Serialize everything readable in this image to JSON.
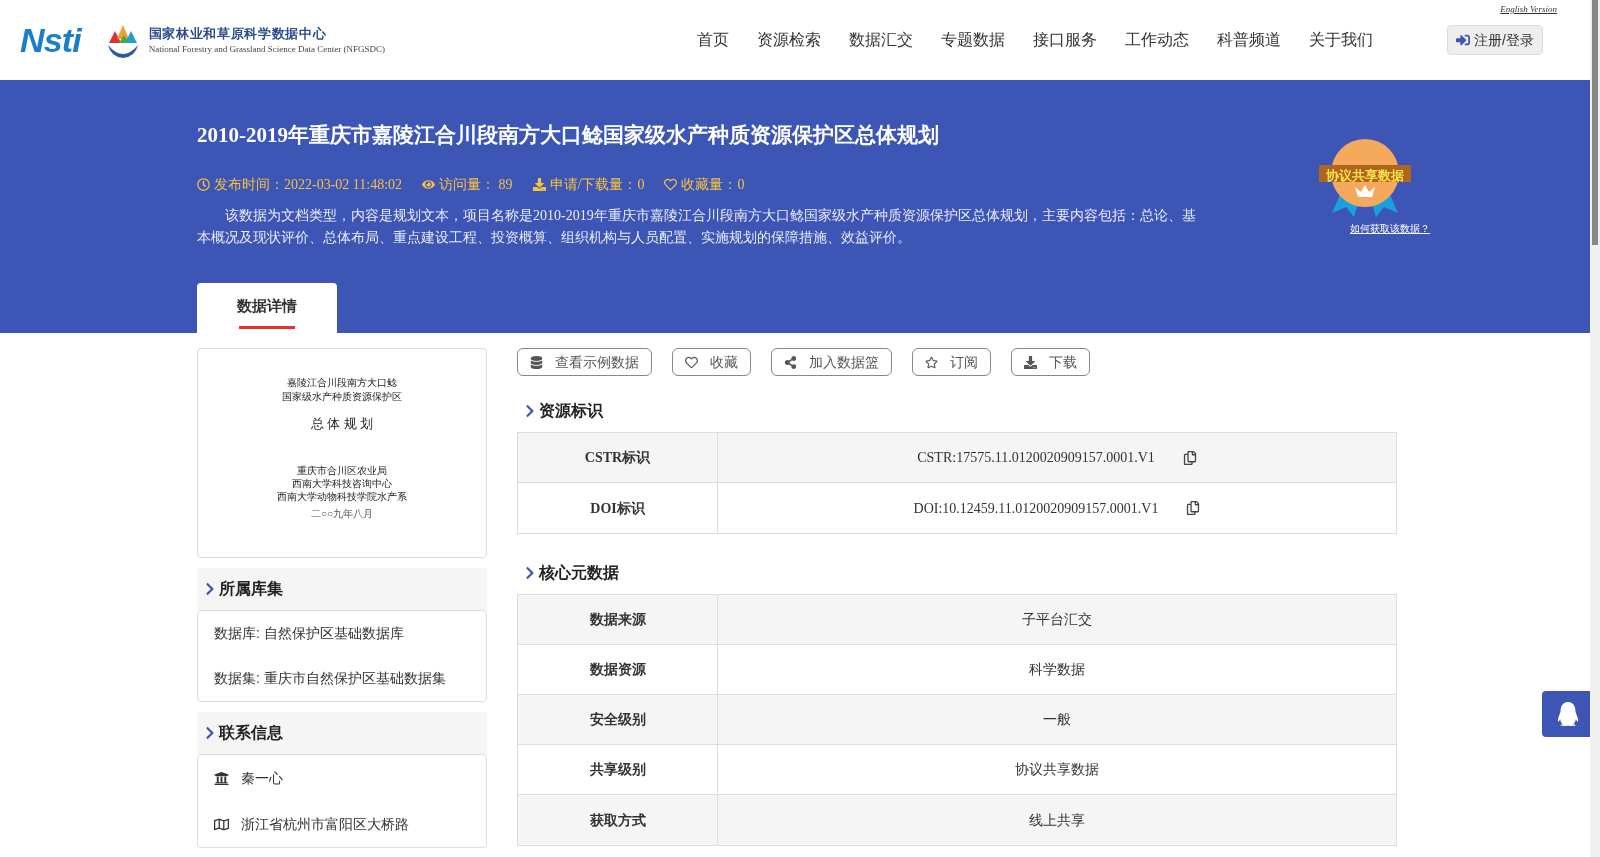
{
  "header": {
    "logo_text": "Nsti",
    "org_name": "国家林业和草原科学数据中心",
    "org_name_en": "National Forestry and Grassland Science Data Center (NFGSDC)",
    "english_link": "English Version",
    "nav": [
      {
        "label": "首页",
        "selected": false
      },
      {
        "label": "资源检索",
        "selected": false
      },
      {
        "label": "数据汇交",
        "selected": false
      },
      {
        "label": "专题数据",
        "selected": false
      },
      {
        "label": "接口服务",
        "selected": false
      },
      {
        "label": "工作动态",
        "selected": false
      },
      {
        "label": "科普频道",
        "selected": false
      },
      {
        "label": "关于我们",
        "selected": false
      }
    ],
    "login_button": "注册/登录"
  },
  "banner": {
    "title": "2010-2019年重庆市嘉陵江合川段南方大口鲶国家级水产种质资源保护区总体规划",
    "meta": [
      {
        "kind": "time",
        "text": "发布时间：2022-03-02 11:48:02"
      },
      {
        "kind": "views",
        "text": "访问量： 89"
      },
      {
        "kind": "downloads",
        "text": "申请/下载量：0"
      },
      {
        "kind": "favorites",
        "text": "收藏量：0"
      }
    ],
    "description": "该数据为文档类型，内容是规划文本，项目名称是2010-2019年重庆市嘉陵江合川段南方大口鲶国家级水产种质资源保护区总体规划，主要内容包括：总论、基本概况及现状评价、总体布局、重点建设工程、投资概算、组织机构与人员配置、实施规划的保障措施、效益评价。",
    "badge": "协议共享数据",
    "badge_link": "如何获取该数据？",
    "tabs": [
      {
        "label": "数据详情",
        "selected": true
      }
    ]
  },
  "document_thumbnail": {
    "lines": [
      "嘉陵江合川段南方大口鲶",
      "国家级水产种质资源保护区"
    ],
    "heading": "总 体 规 划",
    "footer_lines": [
      "重庆市合川区农业局",
      "西南大学科技咨询中心",
      "西南大学动物科技学院水产系"
    ],
    "date": "二○○九年八月"
  },
  "collection": {
    "title": "所属库集",
    "items": [
      "数据库: 自然保护区基础数据库",
      "数据集: 重庆市自然保护区基础数据集"
    ]
  },
  "contact": {
    "title": "联系信息",
    "items": [
      {
        "kind": "institution",
        "text": "秦一心"
      },
      {
        "kind": "address",
        "text": "浙江省杭州市富阳区大桥路"
      }
    ]
  },
  "actions": [
    {
      "kind": "sample",
      "label": "查看示例数据"
    },
    {
      "kind": "favorite",
      "label": "收藏"
    },
    {
      "kind": "basket",
      "label": "加入数据篮"
    },
    {
      "kind": "subscribe",
      "label": "订阅"
    },
    {
      "kind": "download",
      "label": "下载"
    }
  ],
  "identifiers": {
    "title": "资源标识",
    "rows": [
      {
        "label": "CSTR标识",
        "value": "CSTR:17575.11.0120020909157.0001.V1"
      },
      {
        "label": "DOI标识",
        "value": "DOI:10.12459.11.0120020909157.0001.V1"
      }
    ]
  },
  "core_metadata": {
    "title": "核心元数据",
    "rows": [
      {
        "label": "数据来源",
        "value": "子平台汇交"
      },
      {
        "label": "数据资源",
        "value": "科学数据"
      },
      {
        "label": "安全级别",
        "value": "一般"
      },
      {
        "label": "共享级别",
        "value": "协议共享数据"
      },
      {
        "label": "获取方式",
        "value": "线上共享"
      }
    ]
  }
}
